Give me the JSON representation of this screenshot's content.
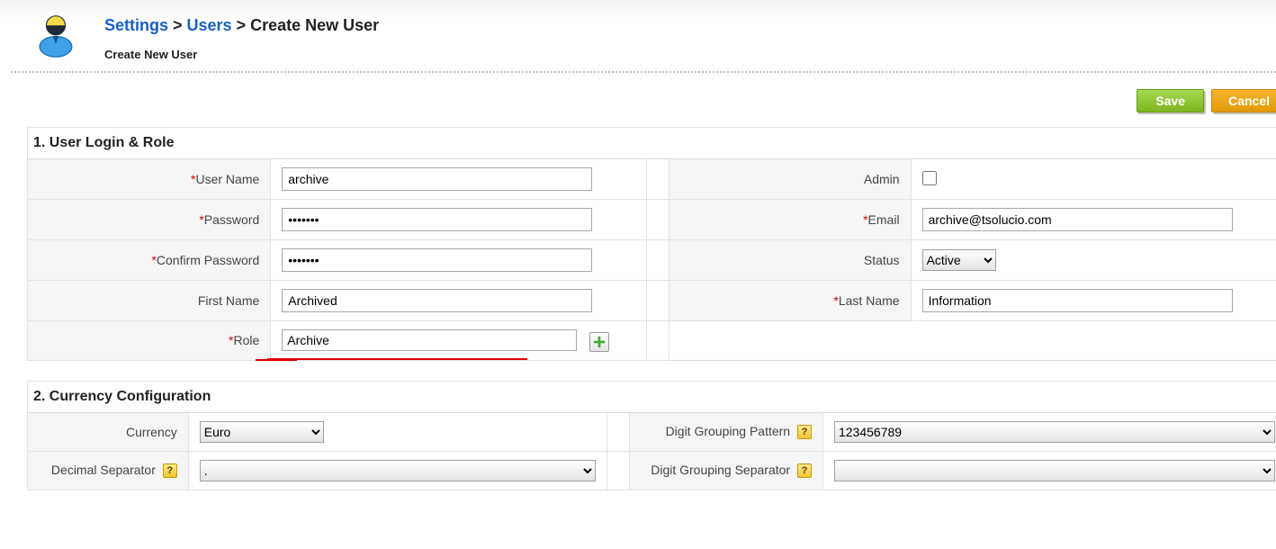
{
  "breadcrumb": {
    "settings": "Settings",
    "sep": " > ",
    "users": "Users",
    "current": "Create New User"
  },
  "subtitle": "Create New User",
  "buttons": {
    "save": "Save",
    "cancel": "Cancel"
  },
  "section1": {
    "heading": "1. User Login & Role",
    "labels": {
      "user_name": "User Name",
      "admin": "Admin",
      "password": "Password",
      "email": "Email",
      "confirm_password": "Confirm Password",
      "status": "Status",
      "first_name": "First Name",
      "last_name": "Last Name",
      "role": "Role"
    },
    "values": {
      "user_name": "archive",
      "password": "•••••••",
      "confirm_password": "•••••••",
      "email": "archive@tsolucio.com",
      "status": "Active",
      "first_name": "Archived",
      "last_name": "Information",
      "role": "Archive"
    }
  },
  "section2": {
    "heading": "2. Currency Configuration",
    "labels": {
      "currency": "Currency",
      "digit_grouping_pattern": "Digit Grouping Pattern",
      "decimal_separator": "Decimal Separator",
      "digit_grouping_separator": "Digit Grouping Separator"
    },
    "values": {
      "currency": "Euro",
      "digit_grouping_pattern": "123456789",
      "decimal_separator": ".",
      "digit_grouping_separator": ""
    }
  }
}
